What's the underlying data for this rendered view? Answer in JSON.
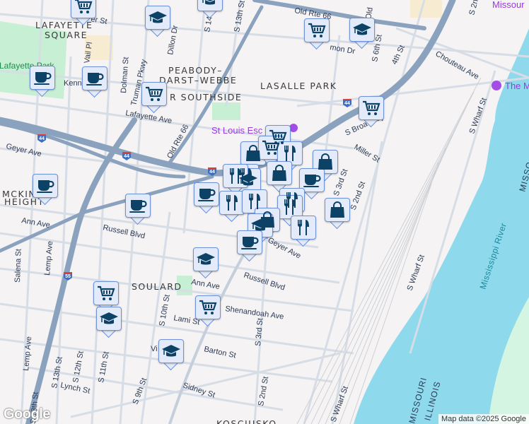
{
  "map": {
    "neighborhoods": [
      "LAFAYETTE",
      "SQUARE",
      "PEABODY–",
      "DARST–WEBBE",
      "R SOUTHSIDE",
      "LASALLE PARK",
      "MCKIN",
      "HEIGHT",
      "SOULARD",
      "KOSCIUSKO"
    ],
    "parks": [
      "Lafayette Park"
    ],
    "pois": [
      "St Louis Esc",
      "The M",
      "Missour"
    ],
    "streets": [
      "Old Rte 66",
      "Old Rte 66",
      "S 14th St",
      "S 13th St",
      "Dillon Dr",
      "Truman Pkwy",
      "Dolman St",
      "Vail Pl",
      "Kenn",
      "Lafayette Ave",
      "Geyer Ave",
      "Ann Ave",
      "Russell Blvd",
      "Salena St",
      "Lemp Ave",
      "Lemp Ave",
      "S 13th St",
      "S 12th St",
      "S 11th St",
      "Lynch St",
      "S 18th St",
      "S 10th St",
      "Lami St",
      "Shenandoah Ave",
      "Ann Ave",
      "Russell Blvd",
      "Barton St",
      "Sidney St",
      "S 9th St",
      "S 3rd St",
      "S 2nd St",
      "Geyer Ave",
      "Miller St",
      "S Broadway",
      "S 3rd St",
      "S 2nd St",
      "S 6th St",
      "4th St",
      "Chouteau Ave",
      "S Wharf St",
      "S Wharf St",
      "S Wharf St",
      "S 2nd St",
      "Old",
      "mon Dr",
      "er St",
      "Vi"
    ],
    "highway_shields": [
      "44",
      "44",
      "44",
      "44",
      "55"
    ],
    "river": "Mississippi River",
    "state_labels": [
      "MISSOURI",
      "ILLINOIS",
      "MISSO"
    ]
  },
  "markers": [
    {
      "type": "cart"
    },
    {
      "type": "grad"
    },
    {
      "type": "grad"
    },
    {
      "type": "cart"
    },
    {
      "type": "grad"
    },
    {
      "type": "coffee"
    },
    {
      "type": "coffee"
    },
    {
      "type": "cart"
    },
    {
      "type": "cart"
    },
    {
      "type": "coffee"
    },
    {
      "type": "coffee"
    },
    {
      "type": "cart"
    },
    {
      "type": "bag"
    },
    {
      "type": "cart"
    },
    {
      "type": "food"
    },
    {
      "type": "food"
    },
    {
      "type": "bag"
    },
    {
      "type": "bag"
    },
    {
      "type": "coffee"
    },
    {
      "type": "grad"
    },
    {
      "type": "food"
    },
    {
      "type": "coffee"
    },
    {
      "type": "food"
    },
    {
      "type": "food"
    },
    {
      "type": "food"
    },
    {
      "type": "food"
    },
    {
      "type": "bag"
    },
    {
      "type": "grad"
    },
    {
      "type": "food"
    },
    {
      "type": "coffee"
    },
    {
      "type": "bag"
    },
    {
      "type": "grad"
    },
    {
      "type": "cart"
    },
    {
      "type": "grad"
    },
    {
      "type": "cart"
    },
    {
      "type": "grad"
    }
  ],
  "attribution": "Map data ©2025 Google",
  "logo": "Google",
  "colors": {
    "water": "#8fd9ec",
    "park": "#c6efd3",
    "highway": "#8aa2bd",
    "marker_bg": "#e3ebfb",
    "marker_border": "#6d92d8",
    "icon": "#0c4266",
    "poi": "#a34de6"
  }
}
